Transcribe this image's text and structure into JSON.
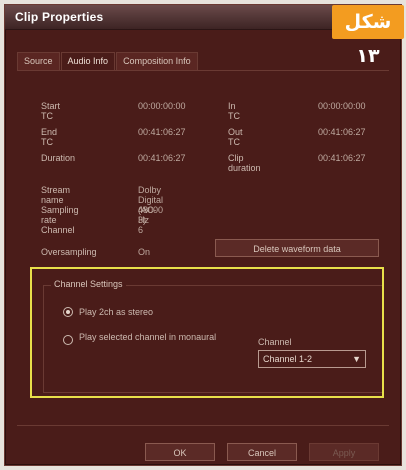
{
  "window": {
    "title": "Clip Properties"
  },
  "badge": {
    "text": "شکل ۱۳",
    "color": "#f39c20"
  },
  "tabs": [
    {
      "label": "Source",
      "active": false
    },
    {
      "label": "Audio Info",
      "active": true
    },
    {
      "label": "Composition Info",
      "active": false
    }
  ],
  "timecodes": [
    {
      "label": "Start TC",
      "value": "00:00:00:00",
      "label2": "In TC",
      "value2": "00:00:00:00"
    },
    {
      "label": "End TC",
      "value": "00:41:06:27",
      "label2": "Out TC",
      "value2": "00:41:06:27"
    },
    {
      "label": "Duration",
      "value": "00:41:06:27",
      "label2": "Clip duration",
      "value2": "00:41:06:27"
    }
  ],
  "audio_info": [
    {
      "label": "Stream name",
      "value": "Dolby Digital (AC-3)"
    },
    {
      "label": "Sampling rate",
      "value": "48000 Hz"
    },
    {
      "label": "Channel",
      "value": "6"
    },
    {
      "label": "Oversampling",
      "value": "On"
    }
  ],
  "waveform_button": "Delete waveform data",
  "channel_settings": {
    "title": "Channel Settings",
    "play_all_label": "Play 2ch as stereo",
    "selected_label": "Play selected channel in monaural",
    "channel_field_label": "Channel",
    "channel_value": "Channel 1-2"
  },
  "footer": {
    "ok": "OK",
    "cancel": "Cancel",
    "apply": "Apply"
  }
}
